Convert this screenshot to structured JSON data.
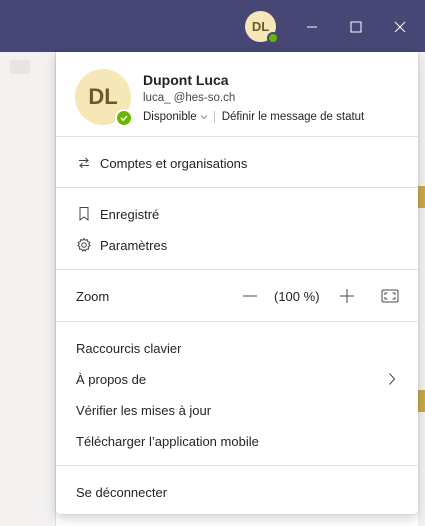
{
  "titlebar": {
    "avatar_initials": "DL",
    "presence_color": "#6bb700",
    "bar_color": "#464775",
    "buttons": [
      "minimize-icon",
      "maximize-icon",
      "close-icon"
    ]
  },
  "profile": {
    "initials": "DL",
    "name": "Dupont Luca",
    "email": "luca_     @hes-so.ch",
    "status": "Disponible",
    "set_status_message": "Définir le message de statut",
    "presence_color": "#6bb700"
  },
  "menu": {
    "accounts": "Comptes et organisations",
    "saved": "Enregistré",
    "settings": "Paramètres",
    "zoom_label": "Zoom",
    "zoom_value": "(100 %)",
    "shortcuts": "Raccourcis clavier",
    "about": "À propos de",
    "check_updates": "Vérifier les mises à jour",
    "download_mobile": "Télécharger l’application mobile",
    "sign_out": "Se déconnecter"
  },
  "icons": {
    "accounts": "switch-arrows-icon",
    "saved": "bookmark-icon",
    "settings": "gear-icon",
    "about": "chevron-right-icon",
    "zoom_out": "minus-icon",
    "zoom_in": "plus-icon",
    "fit": "fullscreen-icon"
  }
}
